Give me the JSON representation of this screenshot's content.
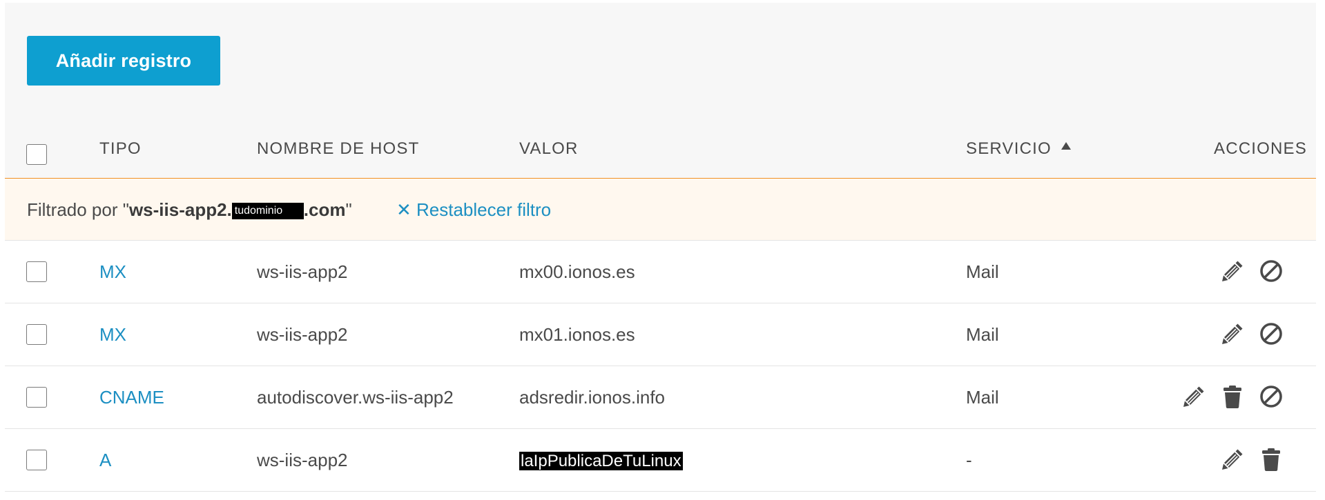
{
  "toolbar": {
    "add_record_label": "Añadir registro"
  },
  "table": {
    "headers": {
      "tipo": "TIPO",
      "host": "NOMBRE DE HOST",
      "valor": "VALOR",
      "servicio": "SERVICIO",
      "acciones": "ACCIONES"
    },
    "sort": {
      "column": "SERVICIO",
      "direction": "ascending"
    }
  },
  "filter": {
    "prefix": "Filtrado por \"",
    "domain_start": "ws-iis-app2.",
    "domain_redacted": "tudominio",
    "domain_end": ".com",
    "suffix": "\"",
    "reset_label": "✕ Restablecer filtro"
  },
  "rows": [
    {
      "type": "MX",
      "host": "ws-iis-app2",
      "value": "mx00.ionos.es",
      "service": "Mail",
      "actions": [
        "edit",
        "disable"
      ]
    },
    {
      "type": "MX",
      "host": "ws-iis-app2",
      "value": "mx01.ionos.es",
      "service": "Mail",
      "actions": [
        "edit",
        "disable"
      ]
    },
    {
      "type": "CNAME",
      "host": "autodiscover.ws-iis-app2",
      "value": "adsredir.ionos.info",
      "service": "Mail",
      "actions": [
        "edit",
        "delete",
        "disable"
      ]
    },
    {
      "type": "A",
      "host": "ws-iis-app2",
      "value": "laIpPublicaDeTuLinux",
      "service": "-",
      "actions": [
        "edit",
        "delete"
      ]
    }
  ],
  "icons": {
    "edit": "pencil-icon",
    "delete": "trash-icon",
    "disable": "block-icon"
  },
  "colors": {
    "primary_button": "#0e9fd0",
    "link": "#1c8fc2",
    "filter_background": "#fff8ef",
    "header_divider": "#f09022"
  }
}
